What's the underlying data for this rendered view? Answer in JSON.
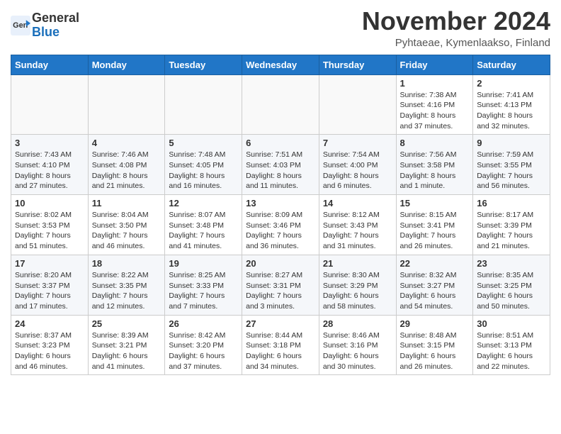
{
  "logo": {
    "line1": "General",
    "line2": "Blue"
  },
  "title": "November 2024",
  "location": "Pyhtaeae, Kymenlaakso, Finland",
  "weekdays": [
    "Sunday",
    "Monday",
    "Tuesday",
    "Wednesday",
    "Thursday",
    "Friday",
    "Saturday"
  ],
  "weeks": [
    [
      {
        "day": "",
        "info": ""
      },
      {
        "day": "",
        "info": ""
      },
      {
        "day": "",
        "info": ""
      },
      {
        "day": "",
        "info": ""
      },
      {
        "day": "",
        "info": ""
      },
      {
        "day": "1",
        "info": "Sunrise: 7:38 AM\nSunset: 4:16 PM\nDaylight: 8 hours\nand 37 minutes."
      },
      {
        "day": "2",
        "info": "Sunrise: 7:41 AM\nSunset: 4:13 PM\nDaylight: 8 hours\nand 32 minutes."
      }
    ],
    [
      {
        "day": "3",
        "info": "Sunrise: 7:43 AM\nSunset: 4:10 PM\nDaylight: 8 hours\nand 27 minutes."
      },
      {
        "day": "4",
        "info": "Sunrise: 7:46 AM\nSunset: 4:08 PM\nDaylight: 8 hours\nand 21 minutes."
      },
      {
        "day": "5",
        "info": "Sunrise: 7:48 AM\nSunset: 4:05 PM\nDaylight: 8 hours\nand 16 minutes."
      },
      {
        "day": "6",
        "info": "Sunrise: 7:51 AM\nSunset: 4:03 PM\nDaylight: 8 hours\nand 11 minutes."
      },
      {
        "day": "7",
        "info": "Sunrise: 7:54 AM\nSunset: 4:00 PM\nDaylight: 8 hours\nand 6 minutes."
      },
      {
        "day": "8",
        "info": "Sunrise: 7:56 AM\nSunset: 3:58 PM\nDaylight: 8 hours\nand 1 minute."
      },
      {
        "day": "9",
        "info": "Sunrise: 7:59 AM\nSunset: 3:55 PM\nDaylight: 7 hours\nand 56 minutes."
      }
    ],
    [
      {
        "day": "10",
        "info": "Sunrise: 8:02 AM\nSunset: 3:53 PM\nDaylight: 7 hours\nand 51 minutes."
      },
      {
        "day": "11",
        "info": "Sunrise: 8:04 AM\nSunset: 3:50 PM\nDaylight: 7 hours\nand 46 minutes."
      },
      {
        "day": "12",
        "info": "Sunrise: 8:07 AM\nSunset: 3:48 PM\nDaylight: 7 hours\nand 41 minutes."
      },
      {
        "day": "13",
        "info": "Sunrise: 8:09 AM\nSunset: 3:46 PM\nDaylight: 7 hours\nand 36 minutes."
      },
      {
        "day": "14",
        "info": "Sunrise: 8:12 AM\nSunset: 3:43 PM\nDaylight: 7 hours\nand 31 minutes."
      },
      {
        "day": "15",
        "info": "Sunrise: 8:15 AM\nSunset: 3:41 PM\nDaylight: 7 hours\nand 26 minutes."
      },
      {
        "day": "16",
        "info": "Sunrise: 8:17 AM\nSunset: 3:39 PM\nDaylight: 7 hours\nand 21 minutes."
      }
    ],
    [
      {
        "day": "17",
        "info": "Sunrise: 8:20 AM\nSunset: 3:37 PM\nDaylight: 7 hours\nand 17 minutes."
      },
      {
        "day": "18",
        "info": "Sunrise: 8:22 AM\nSunset: 3:35 PM\nDaylight: 7 hours\nand 12 minutes."
      },
      {
        "day": "19",
        "info": "Sunrise: 8:25 AM\nSunset: 3:33 PM\nDaylight: 7 hours\nand 7 minutes."
      },
      {
        "day": "20",
        "info": "Sunrise: 8:27 AM\nSunset: 3:31 PM\nDaylight: 7 hours\nand 3 minutes."
      },
      {
        "day": "21",
        "info": "Sunrise: 8:30 AM\nSunset: 3:29 PM\nDaylight: 6 hours\nand 58 minutes."
      },
      {
        "day": "22",
        "info": "Sunrise: 8:32 AM\nSunset: 3:27 PM\nDaylight: 6 hours\nand 54 minutes."
      },
      {
        "day": "23",
        "info": "Sunrise: 8:35 AM\nSunset: 3:25 PM\nDaylight: 6 hours\nand 50 minutes."
      }
    ],
    [
      {
        "day": "24",
        "info": "Sunrise: 8:37 AM\nSunset: 3:23 PM\nDaylight: 6 hours\nand 46 minutes."
      },
      {
        "day": "25",
        "info": "Sunrise: 8:39 AM\nSunset: 3:21 PM\nDaylight: 6 hours\nand 41 minutes."
      },
      {
        "day": "26",
        "info": "Sunrise: 8:42 AM\nSunset: 3:20 PM\nDaylight: 6 hours\nand 37 minutes."
      },
      {
        "day": "27",
        "info": "Sunrise: 8:44 AM\nSunset: 3:18 PM\nDaylight: 6 hours\nand 34 minutes."
      },
      {
        "day": "28",
        "info": "Sunrise: 8:46 AM\nSunset: 3:16 PM\nDaylight: 6 hours\nand 30 minutes."
      },
      {
        "day": "29",
        "info": "Sunrise: 8:48 AM\nSunset: 3:15 PM\nDaylight: 6 hours\nand 26 minutes."
      },
      {
        "day": "30",
        "info": "Sunrise: 8:51 AM\nSunset: 3:13 PM\nDaylight: 6 hours\nand 22 minutes."
      }
    ]
  ]
}
